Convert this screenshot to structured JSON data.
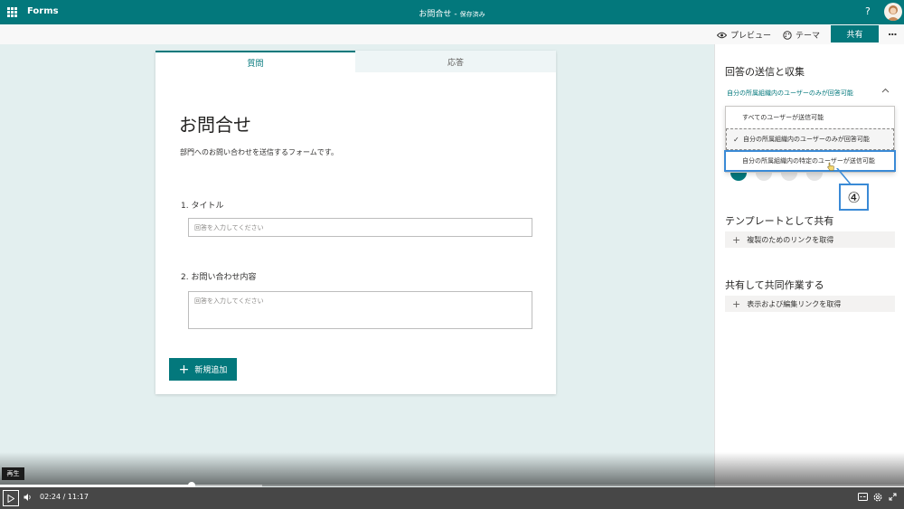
{
  "app": {
    "name": "Forms",
    "doc_title": "お問合せ",
    "doc_status": "保存済み",
    "help_label": "?"
  },
  "toolbar": {
    "preview_label": "プレビュー",
    "theme_label": "テーマ",
    "share_label": "共有",
    "more_label": "..."
  },
  "form": {
    "tabs": [
      {
        "label": "質問",
        "active": true
      },
      {
        "label": "応答",
        "active": false
      }
    ],
    "title": "お問合せ",
    "description": "部門へのお問い合わせを送信するフォームです。",
    "questions": [
      {
        "label": "1. タイトル",
        "placeholder": "回答を入力してください"
      },
      {
        "label": "2. お問い合わせ内容",
        "placeholder": "回答を入力してください"
      }
    ],
    "add_button_label": "新規追加"
  },
  "panel": {
    "heading": "回答の送信と収集",
    "selected_option": "自分の所属組織内のユーザーのみが回答可能",
    "dropdown_options": [
      {
        "label": "すべてのユーザーが送信可能",
        "checked": false
      },
      {
        "label": "自分の所属組織内のユーザーのみが回答可能",
        "checked": true
      },
      {
        "label": "自分の所属組織内の特定のユーザーが送信可能",
        "checked": false
      }
    ],
    "template_heading": "テンプレートとして共有",
    "template_link": "複製のためのリンクを取得",
    "collab_heading": "共有して共同作業する",
    "collab_link": "表示および編集リンクを取得"
  },
  "callout": {
    "label": "④"
  },
  "player": {
    "tooltip": "再生",
    "current_time": "02:24",
    "time_sep": "/",
    "total_time": "11:17",
    "progress": 0.2124,
    "buffered": 0.29
  },
  "colors": {
    "accent": "#03787c",
    "highlight": "#3a8ad6"
  }
}
